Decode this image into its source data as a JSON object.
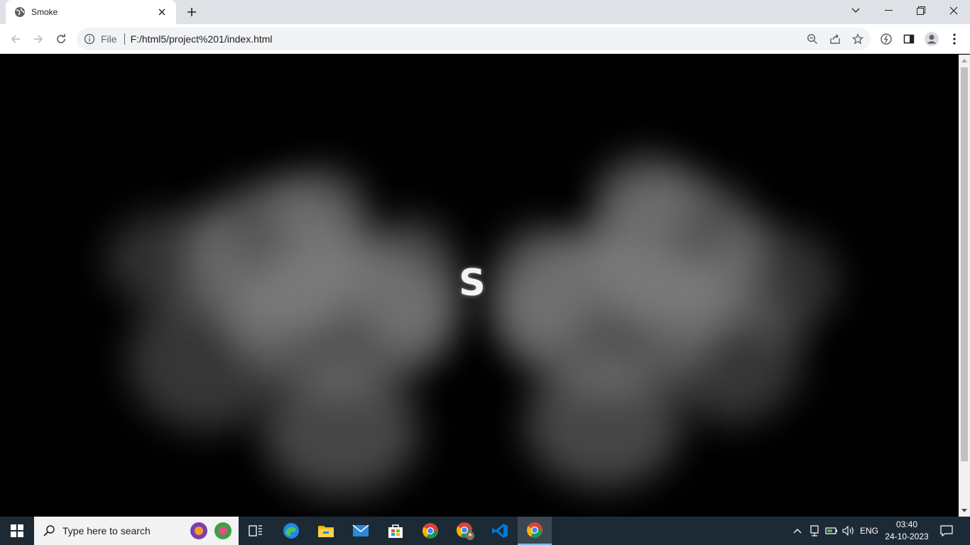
{
  "browser": {
    "tab": {
      "title": "Smoke",
      "favicon": "globe-icon"
    },
    "address_bar": {
      "scheme_label": "File",
      "url": "F:/html5/project%201/index.html"
    }
  },
  "page": {
    "center_text": "S",
    "background_color": "#000000",
    "smoke_color": "#9a9a9a"
  },
  "taskbar": {
    "search_placeholder": "Type here to search",
    "apps": [
      "task-view-icon",
      "edge-icon",
      "file-explorer-icon",
      "mail-icon",
      "store-icon",
      "chrome-icon",
      "chrome-profile-icon",
      "vscode-icon",
      "chrome-active-icon"
    ],
    "tray": {
      "language": "ENG",
      "time": "03:40",
      "date": "24-10-2023"
    }
  }
}
